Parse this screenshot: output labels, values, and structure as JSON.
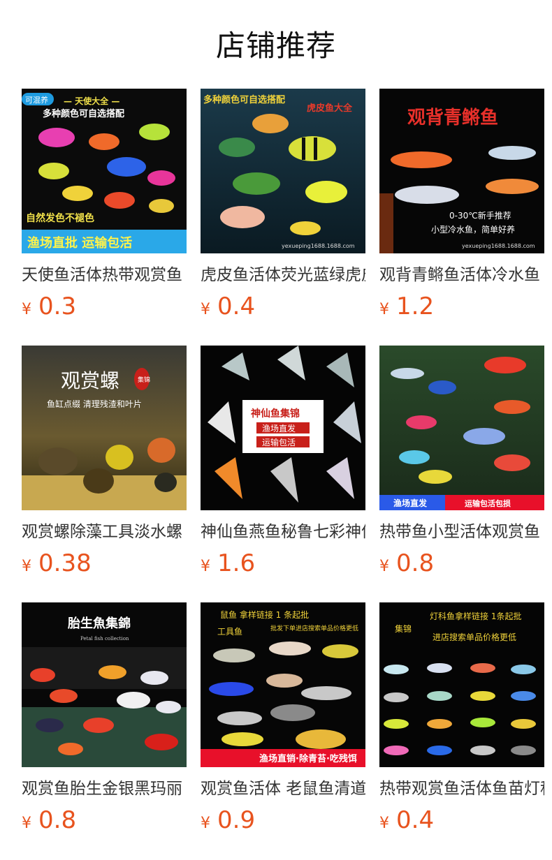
{
  "page_title": "店铺推荐",
  "products": [
    {
      "name": "天使鱼活体热带观赏鱼",
      "currency": "¥",
      "price": "0.3",
      "image_text": [
        "可混养",
        "— 天使大全 —",
        "多种颜色可自选搭配",
        "自然发色不褪色",
        "渔场直批 运输包活"
      ]
    },
    {
      "name": "虎皮鱼活体荧光蓝绿虎皮",
      "currency": "¥",
      "price": "0.4",
      "image_text": [
        "多种颜色可自选搭配",
        "虎皮鱼大全",
        "yexueping1688.1688.com"
      ]
    },
    {
      "name": "观背青鳉鱼活体冷水鱼",
      "currency": "¥",
      "price": "1.2",
      "image_text": [
        "观背青鳉鱼",
        "0-30℃新手推荐",
        "小型冷水鱼，简单好养",
        "yexueping1688.1688.com"
      ]
    },
    {
      "name": "观赏螺除藻工具淡水螺",
      "currency": "¥",
      "price": "0.38",
      "image_text": [
        "观赏螺",
        "集锦",
        "鱼缸点缀 清理残渣和叶片"
      ]
    },
    {
      "name": "神仙鱼燕鱼秘鲁七彩神仙",
      "currency": "¥",
      "price": "1.6",
      "image_text": [
        "神仙鱼集锦",
        "渔场直发",
        "运输包活"
      ]
    },
    {
      "name": "热带鱼小型活体观赏鱼",
      "currency": "¥",
      "price": "0.8",
      "image_text": [
        "渔场直发",
        "运输包活包损"
      ]
    },
    {
      "name": "观赏鱼胎生金银黑玛丽",
      "currency": "¥",
      "price": "0.8",
      "image_text": [
        "胎生魚集錦",
        "Petal fish collection"
      ]
    },
    {
      "name": "观赏鱼活体 老鼠鱼清道夫",
      "currency": "¥",
      "price": "0.9",
      "image_text": [
        "鼠鱼 拿样链接 1 条起批",
        "批发下单进店搜索单品价格更低",
        "工具鱼",
        "渔场直销·除青苔·吃残饵"
      ]
    },
    {
      "name": "热带观赏鱼活体鱼苗灯科",
      "currency": "¥",
      "price": "0.4",
      "image_text": [
        "灯科鱼拿样链接 1条起批",
        "集锦",
        "进店搜索单品价格更低"
      ]
    }
  ],
  "colors": {
    "price": "#e8531e",
    "title": "#111111",
    "name": "#333333"
  }
}
